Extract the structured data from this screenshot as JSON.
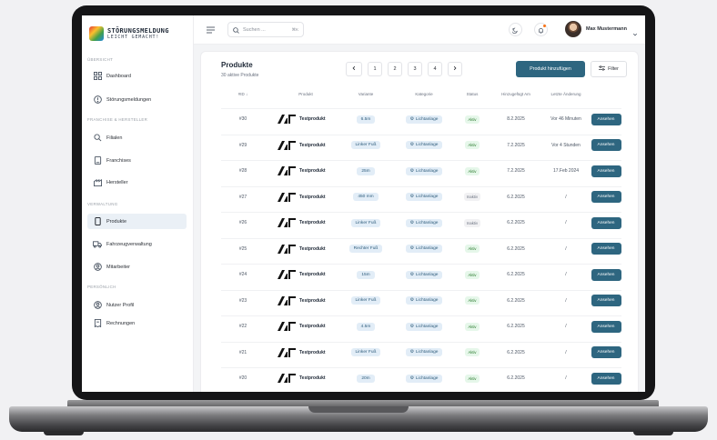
{
  "brand": {
    "line1": "STÖRUNGSMELDUNG",
    "line2": "LEICHT GEMACHT!"
  },
  "sidebar": {
    "sections": [
      {
        "title": "ÜBERSICHT",
        "items": [
          {
            "label": "Dashboard",
            "icon": "grid-icon"
          },
          {
            "label": "Störungsmeldungen",
            "icon": "alert-icon"
          }
        ]
      },
      {
        "title": "FRANCHISE & HERSTELLER",
        "items": [
          {
            "label": "Filialen",
            "icon": "store-icon"
          },
          {
            "label": "Franchises",
            "icon": "doc-icon"
          },
          {
            "label": "Hersteller",
            "icon": "factory-icon"
          }
        ]
      },
      {
        "title": "VERWALTUNG",
        "items": [
          {
            "label": "Produkte",
            "icon": "phone-icon",
            "active": true
          },
          {
            "label": "Fahrzeugverwaltung",
            "icon": "truck-icon"
          },
          {
            "label": "Mitarbeiter",
            "icon": "user-icon"
          }
        ]
      },
      {
        "title": "PERSÖNLICH",
        "items": [
          {
            "label": "Nutzer Profil",
            "icon": "user-circle-icon"
          },
          {
            "label": "Rechnungen",
            "icon": "receipt-icon"
          }
        ]
      }
    ]
  },
  "header": {
    "search_placeholder": "Suchen ...",
    "search_shortcut": "⌘K",
    "username": "Max Mustermann"
  },
  "panel": {
    "title": "Produkte",
    "subtitle": "30 aktive Produkte",
    "pagination": [
      "1",
      "2",
      "3",
      "4"
    ],
    "add_button": "Produkt hinzufügen",
    "filter_button": "Filter"
  },
  "table": {
    "columns": [
      "#ID ↓",
      "Produkt",
      "Variante",
      "Kategorie",
      "Status",
      "Hinzugefügt Am",
      "Letzte Änderung"
    ],
    "rows": [
      {
        "id": "#30",
        "product": "Testprodukt",
        "variant": "6.5m",
        "category": "Lichtanlage",
        "status": "Aktiv",
        "added": "8.2.2025",
        "changed": "Vor 46 Minuten",
        "action": "Ansehen"
      },
      {
        "id": "#29",
        "product": "Testprodukt",
        "variant": "Linker Fuß",
        "category": "Lichtanlage",
        "status": "Aktiv",
        "added": "7.2.2025",
        "changed": "Vor 4 Stunden",
        "action": "Ansehen"
      },
      {
        "id": "#28",
        "product": "Testprodukt",
        "variant": "25m",
        "category": "Lichtanlage",
        "status": "Aktiv",
        "added": "7.2.2025",
        "changed": "17.Feb 2024",
        "action": "Ansehen"
      },
      {
        "id": "#27",
        "product": "Testprodukt",
        "variant": "450 mm",
        "category": "Lichtanlage",
        "status": "Inaktiv",
        "added": "6.2.2025",
        "changed": "/",
        "action": "Ansehen"
      },
      {
        "id": "#26",
        "product": "Testprodukt",
        "variant": "Linker Fuß",
        "category": "Lichtanlage",
        "status": "Inaktiv",
        "added": "6.2.2025",
        "changed": "/",
        "action": "Ansehen"
      },
      {
        "id": "#25",
        "product": "Testprodukt",
        "variant": "Rechter Fuß",
        "category": "Lichtanlage",
        "status": "Aktiv",
        "added": "6.2.2025",
        "changed": "/",
        "action": "Ansehen"
      },
      {
        "id": "#24",
        "product": "Testprodukt",
        "variant": "15m",
        "category": "Lichtanlage",
        "status": "Aktiv",
        "added": "6.2.2025",
        "changed": "/",
        "action": "Ansehen"
      },
      {
        "id": "#23",
        "product": "Testprodukt",
        "variant": "Linker Fuß",
        "category": "Lichtanlage",
        "status": "Aktiv",
        "added": "6.2.2025",
        "changed": "/",
        "action": "Ansehen"
      },
      {
        "id": "#22",
        "product": "Testprodukt",
        "variant": "4.5m",
        "category": "Lichtanlage",
        "status": "Aktiv",
        "added": "6.2.2025",
        "changed": "/",
        "action": "Ansehen"
      },
      {
        "id": "#21",
        "product": "Testprodukt",
        "variant": "Linker Fuß",
        "category": "Lichtanlage",
        "status": "Aktiv",
        "added": "6.2.2025",
        "changed": "/",
        "action": "Ansehen"
      },
      {
        "id": "#20",
        "product": "Testprodukt",
        "variant": "20m",
        "category": "Lichtanlage",
        "status": "Aktiv",
        "added": "6.2.2025",
        "changed": "/",
        "action": "Ansehen"
      }
    ]
  },
  "colors": {
    "accent": "#2e6680",
    "active_nav": "#eaf0f6",
    "pill": "#e2edf7",
    "status_active": "#2e7d32"
  }
}
